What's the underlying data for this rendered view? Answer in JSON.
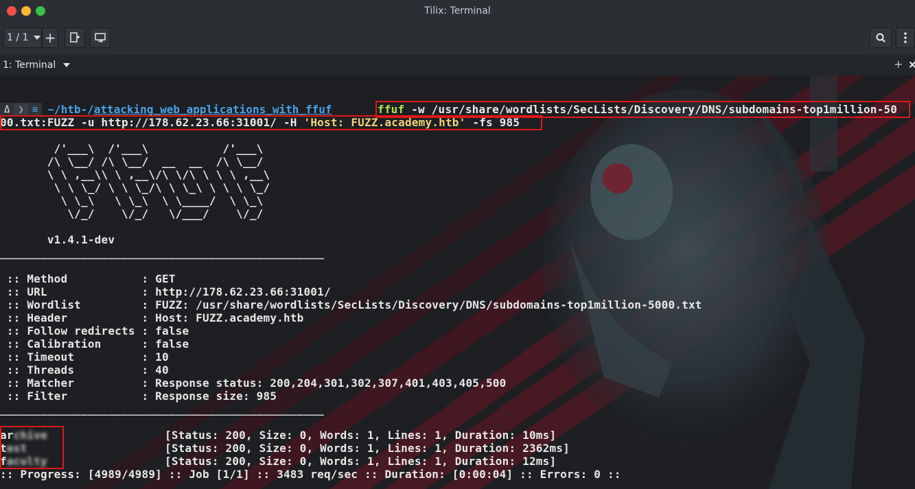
{
  "window": {
    "title": "Tilix: Terminal",
    "session_label": "1 / 1",
    "tab_label": "1: Terminal"
  },
  "icons": {
    "close": "close-dot",
    "minimize": "minimize-dot",
    "maximize": "maximize-dot",
    "add": "plus-icon",
    "new_window": "add-terminal-icon",
    "sync": "sync-input-icon",
    "search": "search-icon",
    "menu": "kebab-menu-icon",
    "tab_dropdown": "chevron-down-icon"
  },
  "prompt": {
    "os_glyph": "Δ",
    "arrow": "❯",
    "git_glyph": "≡",
    "path_prefix": "~/htb-/",
    "path_dir": "attacking_web_applications_with_ffuf"
  },
  "command": {
    "exe": "ffuf",
    "line1_rest": " -w /usr/share/wordlists/SecLists/Discovery/DNS/subdomains-top1million-50",
    "line2_pre": "00.txt:FUZZ -u http://178.62.23.66:31001/ -H ",
    "line2_str": "'Host: FUZZ.academy.htb'",
    "line2_post": " -fs 985"
  },
  "banner": [
    "        /'___\\  /'___\\           /'___\\",
    "       /\\ \\__/ /\\ \\__/  __  __  /\\ \\__/",
    "       \\ \\ ,__\\\\ \\ ,__\\/\\ \\/\\ \\ \\ \\ ,__\\",
    "        \\ \\ \\_/ \\ \\ \\_/\\ \\ \\_\\ \\ \\ \\ \\_/",
    "         \\ \\_\\   \\ \\_\\  \\ \\____/  \\ \\_\\",
    "          \\/_/    \\/_/   \\/___/    \\/_/"
  ],
  "version": "       v1.4.1-dev",
  "separator": "________________________________________________",
  "options": [
    {
      "key": " :: Method           : ",
      "value": "GET"
    },
    {
      "key": " :: URL              : ",
      "value": "http://178.62.23.66:31001/"
    },
    {
      "key": " :: Wordlist         : ",
      "value": "FUZZ: /usr/share/wordlists/SecLists/Discovery/DNS/subdomains-top1million-5000.txt"
    },
    {
      "key": " :: Header           : ",
      "value": "Host: FUZZ.academy.htb"
    },
    {
      "key": " :: Follow redirects : ",
      "value": "false"
    },
    {
      "key": " :: Calibration      : ",
      "value": "false"
    },
    {
      "key": " :: Timeout          : ",
      "value": "10"
    },
    {
      "key": " :: Threads          : ",
      "value": "40"
    },
    {
      "key": " :: Matcher          : ",
      "value": "Response status: 200,204,301,302,307,401,403,405,500"
    },
    {
      "key": " :: Filter           : ",
      "value": "Response size: 985"
    }
  ],
  "results": [
    {
      "first": "ar",
      "blurred": "chive",
      "info": "[Status: 200, Size: 0, Words: 1, Lines: 1, Duration: 10ms]"
    },
    {
      "first": "t",
      "blurred": "est",
      "info": "[Status: 200, Size: 0, Words: 1, Lines: 1, Duration: 2362ms]"
    },
    {
      "first": "f",
      "blurred": "aculty",
      "info": "[Status: 200, Size: 0, Words: 1, Lines: 1, Duration: 12ms]"
    }
  ],
  "progress": ":: Progress: [4989/4989] :: Job [1/1] :: 3483 req/sec :: Duration: [0:00:04] :: Errors: 0 ::",
  "colors": {
    "accent_red": "#e01818",
    "command_green": "#aee24a",
    "string_yellow": "#f2d17a",
    "path_blue": "#4aa3e8"
  }
}
